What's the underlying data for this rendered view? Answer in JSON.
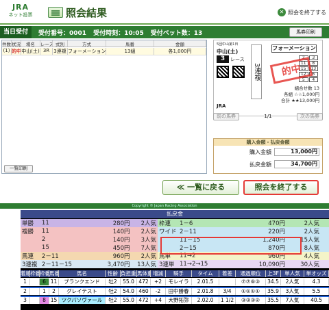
{
  "header": {
    "logo_top": "JRA",
    "logo_bottom": "ネット投票",
    "title": "照会結果",
    "exit_label": "照会を終了する"
  },
  "infobar": {
    "today_tag": "当日受付",
    "receipt": "受付番号：0001",
    "time": "受付時刻：10:05",
    "bet_count": "受付ベット数：13",
    "print_label": "馬券印刷"
  },
  "table": {
    "headers": [
      "件数",
      "状況",
      "場",
      "名",
      "レース",
      "式",
      "別",
      "方",
      "式",
      "馬",
      "番",
      "金",
      "額"
    ],
    "cols": [
      "件数",
      "状況",
      "場名",
      "レース",
      "式別",
      "方式",
      "馬番",
      "金額"
    ],
    "rows": [
      {
        "no": "(1)",
        "status": "的中",
        "venue": "中山(土)",
        "race": "3R",
        "kind": "3連複",
        "method": "フォーメーション",
        "horses": "13組",
        "amount": "各1,000円"
      }
    ],
    "list_print": "一覧印刷"
  },
  "ticket": {
    "race_info": "5回中山第1日",
    "venue": "中山(土)",
    "race_no": "3",
    "race_label": "レース",
    "type": "3連複",
    "formation": "フォーメーション",
    "grid": [
      "2",
      "3",
      "11",
      "8",
      "15",
      "13",
      "12",
      "6",
      "5",
      "4"
    ],
    "stamp": "的中",
    "nums": [
      "組合せ数 13",
      "各組 ☆☆1,000円",
      "合計 ★★13,000円"
    ],
    "jra": "JRA",
    "prev": "前の馬券",
    "page": "1/1",
    "next": "次の馬券"
  },
  "payment": {
    "header": "購入金額・払戻金額",
    "buy_label": "購入金額",
    "buy_value": "13,000円",
    "pay_label": "払戻金額",
    "pay_value": "34,700円"
  },
  "buttons": {
    "back": "≪ 一覧に戻る",
    "end": "照会を終了する"
  },
  "footer": "Copyright © Japan Racing Association",
  "board": {
    "title": "払戻金",
    "rows": [
      {
        "type": "単勝",
        "num": "11",
        "amt": "280円",
        "pop": "2人気",
        "type2": "枠連",
        "num2": "1－6",
        "amt2": "470円",
        "pop2": "2人気",
        "bg": "#c8b4e6",
        "bg2": "#b4e6b4"
      },
      {
        "type": "複勝",
        "num": "11",
        "amt": "140円",
        "pop": "2人気",
        "type2": "ワイド",
        "num2": "2－11",
        "amt2": "220円",
        "pop2": "2人気",
        "bg": "#f4c2c2",
        "bg2": "#c8e6f4"
      },
      {
        "type": "",
        "num": "2",
        "amt": "140円",
        "pop": "3人気",
        "type2": "",
        "num2": "11－15",
        "amt2": "1,240円",
        "pop2": "15人気",
        "bg": "#f4c2c2",
        "bg2": "#c8e6f4"
      },
      {
        "type": "",
        "num": "15",
        "amt": "450円",
        "pop": "7人気",
        "type2": "",
        "num2": "2－15",
        "amt2": "870円",
        "pop2": "8人気",
        "bg": "#f4c2c2",
        "bg2": "#c8e6f4"
      },
      {
        "type": "馬連",
        "num": "2－11",
        "amt": "960円",
        "pop": "2人気",
        "type2": "馬単",
        "num2": "11→2",
        "amt2": "960円",
        "pop2": "4人気",
        "bg": "#f4d8b0",
        "bg2": "#f4f4c8"
      },
      {
        "type": "3連複",
        "num": "2－11－15",
        "amt": "3,470円",
        "pop": "13人気",
        "type2": "3連単",
        "num2": "11→2→15",
        "amt2": "10,090円",
        "pop2": "30人気",
        "bg": "#d8e8f4",
        "bg2": "#e8d8f4"
      }
    ],
    "headers": [
      "着順",
      "枠番",
      "枠番",
      "馬番",
      "馬名",
      "性齢",
      "負担重量",
      "馬体重",
      "増減",
      "騎手",
      "タイム",
      "着差",
      "通過順位",
      "上3F",
      "単人気",
      "単オッズ"
    ],
    "results": [
      {
        "c1": "1",
        "c2": "",
        "c3": "6",
        "c4": "11",
        "c5": "ブランクエンド",
        "c6": "牡2",
        "c7": "55.0",
        "c8": "472",
        "c9": "+2",
        "c10": "モレイラ",
        "c11": "2.01.5",
        "c12": "",
        "c13": "⑦⑦⑥③",
        "c14": "34.5",
        "c15": "2人気",
        "c16": "4.3",
        "waku": "#3a8a3a"
      },
      {
        "c1": "2",
        "c2": "",
        "c3": "1",
        "c4": "2",
        "c5": "グレイテスト",
        "c6": "牡2",
        "c7": "54.0",
        "c8": "460",
        "c9": "-2",
        "c10": "田中勝春",
        "c11": "2.01.8",
        "c12": "3/4",
        "c13": "①①①①",
        "c14": "35.9",
        "c15": "3人気",
        "c16": "5.5",
        "waku": "#ffffff"
      },
      {
        "c1": "3",
        "c2": "",
        "c3": "8",
        "c4": "15",
        "c5": "ツクバソヴァール",
        "c6": "牡2",
        "c7": "55.0",
        "c8": "472",
        "c9": "+4",
        "c10": "大野拓弥",
        "c11": "2.02.0",
        "c12": "1 1/2",
        "c13": "③③③②",
        "c14": "35.5",
        "c15": "7人気",
        "c16": "40.5",
        "waku": "#e68ae6"
      }
    ]
  }
}
